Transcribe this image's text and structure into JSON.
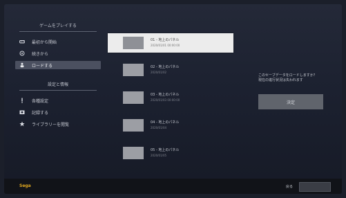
{
  "sidebar": {
    "section1_title": "ゲームをプレイする",
    "section1_items": [
      {
        "label": "最初から開始",
        "icon": "controller-icon"
      },
      {
        "label": "続きから",
        "icon": "circle-icon"
      },
      {
        "label": "ロードする",
        "icon": "person-icon"
      }
    ],
    "section2_title": "設定と情報",
    "section2_items": [
      {
        "label": "各種設定",
        "icon": "exclamation-icon"
      },
      {
        "label": "記録する",
        "icon": "camera-icon"
      },
      {
        "label": "ライブラリーを閲覧",
        "icon": "star-icon"
      }
    ]
  },
  "saves": [
    {
      "title": "01 - 地上のパネル",
      "sub": "2020/01/01 00:00:00"
    },
    {
      "title": "02 - 地上のパネル",
      "sub": "2020/01/02"
    },
    {
      "title": "03 - 地上のパネル",
      "sub": "2020/01/03 00:00:00"
    },
    {
      "title": "04 - 地上のパネル",
      "sub": "2020/01/04"
    },
    {
      "title": "05 - 地上のパネル",
      "sub": "2020/01/05"
    }
  ],
  "right_panel": {
    "text_line1": "このセーブデータをロードしますか？",
    "text_line2": "現在の進行状況は失われます",
    "button_label": "決定"
  },
  "bottom": {
    "brand": "Sega",
    "back_label": "戻る"
  }
}
